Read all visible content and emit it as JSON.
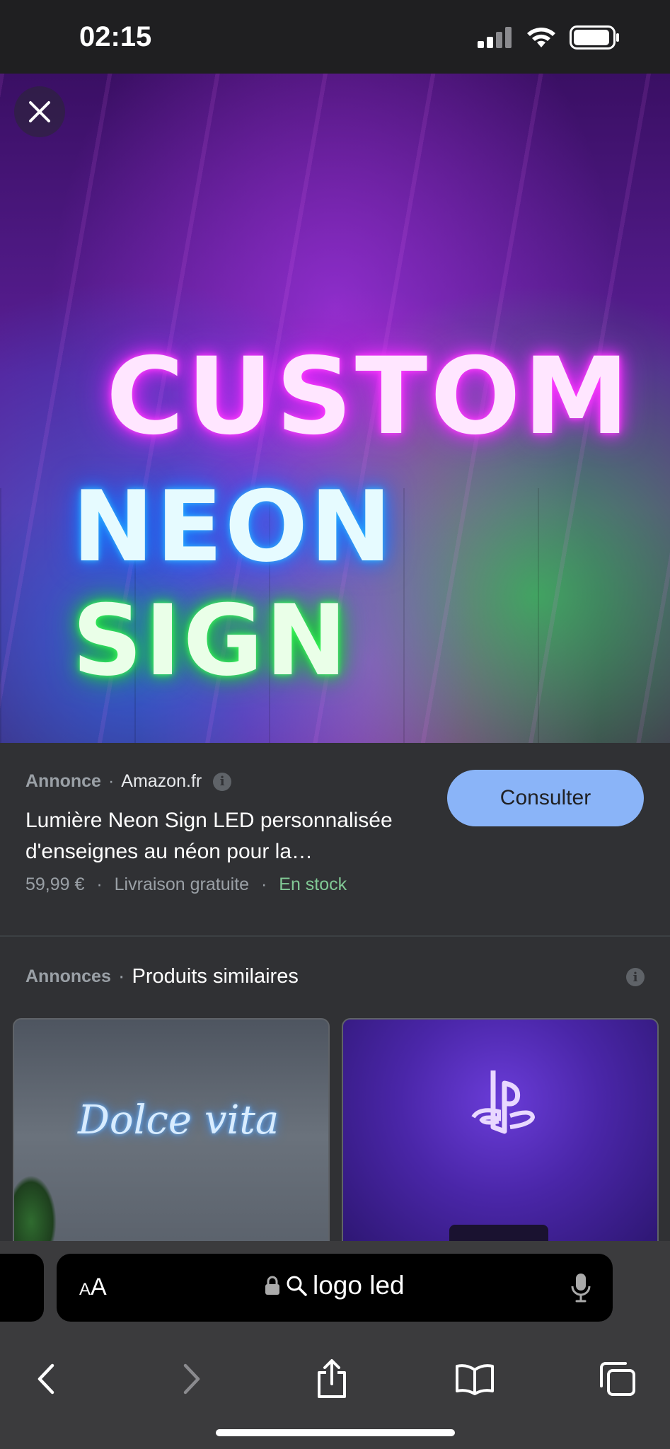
{
  "status_bar": {
    "time": "02:15"
  },
  "hero": {
    "neon_line1": "CUSTOM",
    "neon_word1": "NEON",
    "neon_word2": "SIGN"
  },
  "ad": {
    "label": "Annonce",
    "separator": "·",
    "site": "Amazon.fr",
    "info_icon": "i",
    "title": "Lumière Neon Sign LED personnalisée d'enseignes au néon pour la…",
    "price": "59,99 €",
    "shipping": "Livraison gratuite",
    "availability": "En stock",
    "button_label": "Consulter"
  },
  "similar": {
    "label": "Annonces",
    "separator": "·",
    "title": "Produits similaires",
    "info_icon": "i",
    "card1_neon": "Dolce vita"
  },
  "toolbar": {
    "aa_small": "A",
    "aa_large": "A",
    "url_text": "logo led"
  },
  "colors": {
    "background": "#202124",
    "panel": "#303134",
    "accent_button": "#8ab4f8",
    "stock_green": "#81c995",
    "muted_text": "#9aa0a6"
  },
  "icons": [
    "close-icon",
    "info-icon",
    "lock-icon",
    "search-icon",
    "mic-icon",
    "back-icon",
    "forward-icon",
    "share-icon",
    "bookmarks-icon",
    "tabs-icon",
    "signal-icon",
    "wifi-icon",
    "battery-icon"
  ]
}
